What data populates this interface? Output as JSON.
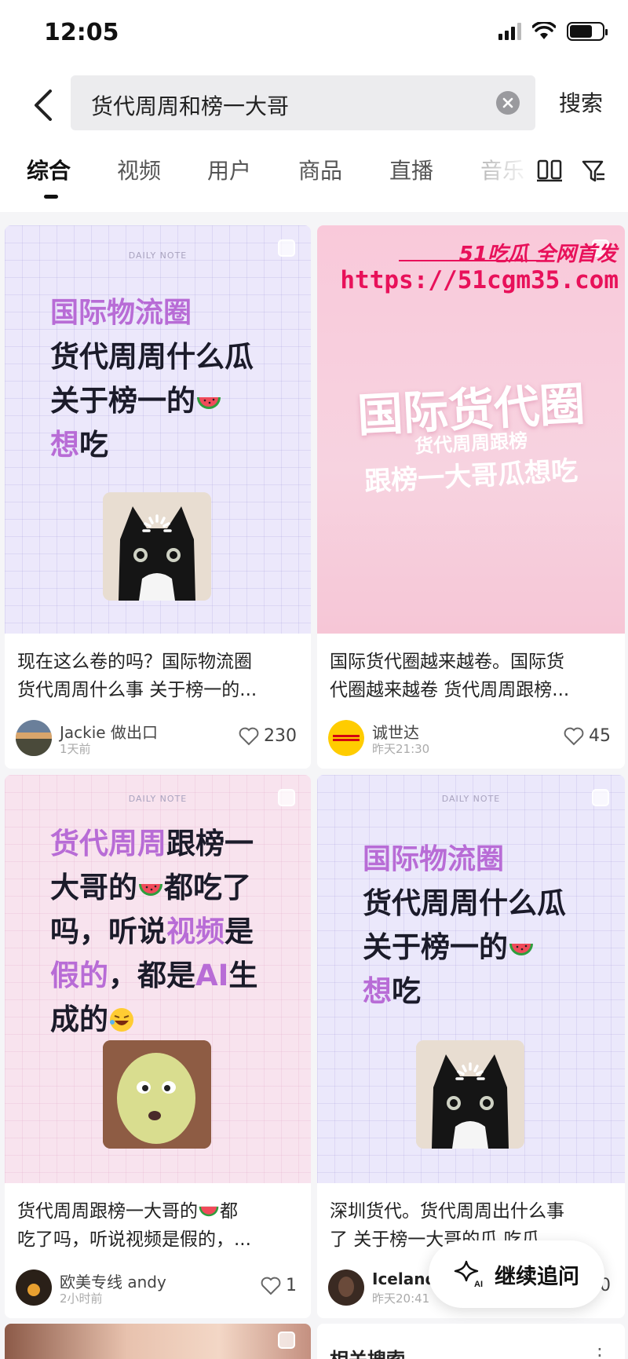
{
  "status_bar": {
    "time": "12:05",
    "battery_level": 0.7
  },
  "search": {
    "query": "货代周周和榜一大哥",
    "submit_label": "搜索"
  },
  "tabs": [
    {
      "label": "综合",
      "active": true
    },
    {
      "label": "视频",
      "active": false
    },
    {
      "label": "用户",
      "active": false
    },
    {
      "label": "商品",
      "active": false
    },
    {
      "label": "直播",
      "active": false
    },
    {
      "label": "音乐",
      "active": false
    }
  ],
  "posts": [
    {
      "cover": {
        "badge": "DAILY NOTE",
        "line1": "国际物流圈",
        "line2": "货代周周什么瓜",
        "line3": "关于榜一的",
        "line4_accent": "想",
        "line4_rest": "吃"
      },
      "title_line1": "现在这么卷的吗？国际物流圈",
      "title_line2": "货代周周什么事 关于榜一的...",
      "author": "Jackie 做出口",
      "time": "1天前",
      "likes": "230"
    },
    {
      "cover": {
        "watermark_brand": "51吃瓜 全网首发",
        "watermark_url": "https://51cgm35.com",
        "headline": "国际货代圈",
        "sub1": "货代周周跟榜",
        "sub2": "跟榜一大哥瓜想吃"
      },
      "title_line1": "国际货代圈越来越卷。国际货",
      "title_line2": "代圈越来越卷 货代周周跟榜...",
      "author": "诚世达",
      "time": "昨天21:30",
      "likes": "45"
    },
    {
      "cover": {
        "badge": "DAILY NOTE",
        "l1_accent": "货代周周",
        "l1_rest": "跟榜一",
        "l2": "大哥的",
        "l2_tail": "都吃了",
        "l3_a": "吗，听说",
        "l3_accent": "视频",
        "l3_b": "是",
        "l4_accent": "假的",
        "l4_a": "，都是",
        "l4_accent2": "AI",
        "l4_b": "生",
        "l5": "成的"
      },
      "title_line1": "货代周周跟榜一大哥的",
      "title_line1_tail": "都",
      "title_line2": "吃了吗，听说视频是假的，...",
      "author": "欧美专线 andy",
      "time": "2小时前",
      "likes": "1"
    },
    {
      "cover": {
        "badge": "DAILY NOTE",
        "line1": "国际物流圈",
        "line2": "货代周周什么瓜",
        "line3": "关于榜一的",
        "line4_accent": "想",
        "line4_rest": "吃"
      },
      "title_line1": "深圳货代。货代周周出什么事",
      "title_line2": "了 关于榜一大哥的瓜 吃瓜",
      "author": "Iceland",
      "time": "昨天20:41",
      "likes": "0"
    }
  ],
  "floating_button": {
    "label": "继续追问",
    "badge": "AI"
  },
  "related_search": {
    "title": "相关搜索"
  },
  "colors": {
    "accent_purple": "#b86cd6",
    "watermark_red": "#e8115a"
  }
}
